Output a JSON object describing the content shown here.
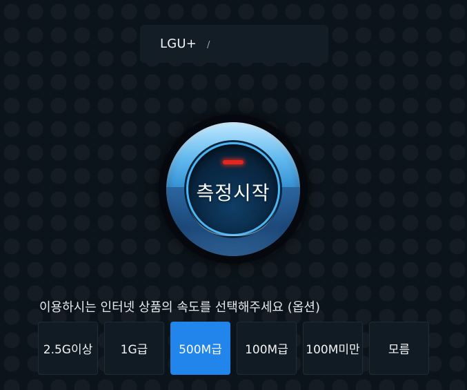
{
  "isp": {
    "name": "LGU+",
    "separator": "/"
  },
  "start_button": {
    "label": "측정시작",
    "led_color": "#e0281e"
  },
  "speed_selection": {
    "prompt": "이용하시는 인터넷 상품의 속도를 선택해주세요 (옵션)",
    "options": [
      {
        "label": "2.5G이상",
        "selected": false
      },
      {
        "label": "1G급",
        "selected": false
      },
      {
        "label": "500M급",
        "selected": true
      },
      {
        "label": "100M급",
        "selected": false
      },
      {
        "label": "100M미만",
        "selected": false
      },
      {
        "label": "모름",
        "selected": false
      }
    ]
  },
  "colors": {
    "background": "#0c141b",
    "accent_selected": "#2185ec",
    "option_background": "#111b23",
    "ring_blue": "#4cb4f0"
  }
}
